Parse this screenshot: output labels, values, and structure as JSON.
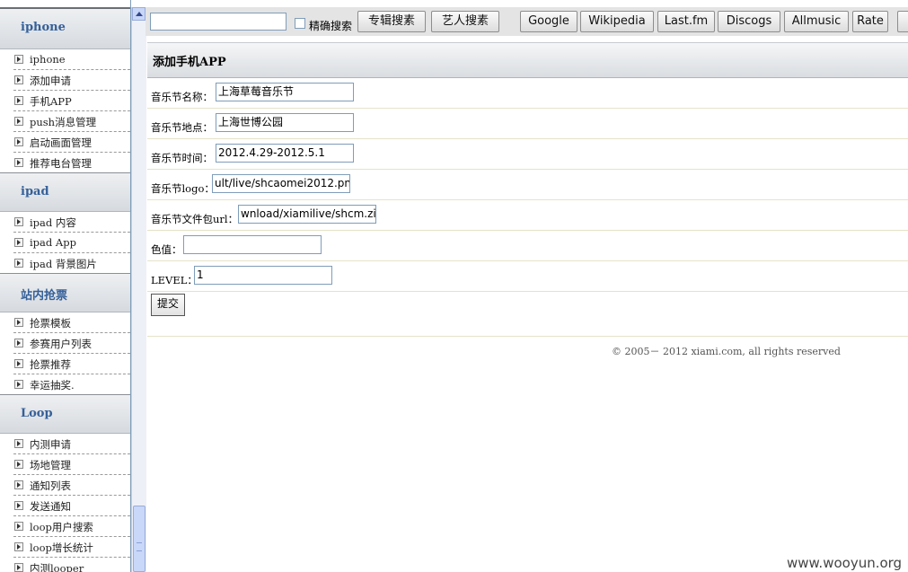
{
  "sidebar": {
    "sections": [
      {
        "title": "iphone",
        "items": [
          "iphone",
          "添加申请",
          "手机APP",
          "push消息管理",
          "启动画面管理",
          "推荐电台管理"
        ]
      },
      {
        "title": "ipad",
        "items": [
          "ipad 内容",
          "ipad App",
          "ipad 背景图片"
        ]
      },
      {
        "title": "站内抢票",
        "items": [
          "抢票模板",
          "参赛用户列表",
          "抢票推荐",
          "幸运抽奖."
        ]
      },
      {
        "title": "Loop",
        "items": [
          "内测申请",
          "场地管理",
          "通知列表",
          "发送通知",
          "loop用户搜索",
          "loop增长统计",
          "内测looper"
        ]
      }
    ]
  },
  "toolbar": {
    "search_value": "",
    "exact_label": "精确搜索",
    "album_search": "专辑搜素",
    "artist_search": "艺人搜素",
    "links": [
      "Google",
      "Wikipedia",
      "Last.fm",
      "Discogs",
      "Allmusic",
      "Rate"
    ]
  },
  "panel": {
    "title": "添加手机APP",
    "fields": [
      {
        "label": "音乐节名称：",
        "value": "上海草莓音乐节"
      },
      {
        "label": "音乐节地点：",
        "value": "上海世博公园"
      },
      {
        "label": "音乐节时间：",
        "value": "2012.4.29-2012.5.1"
      },
      {
        "label": "音乐节logo：",
        "value": "ult/live/shcaomei2012.png"
      },
      {
        "label": "音乐节文件包url：",
        "value": "wnload/xiamilive/shcm.zip"
      },
      {
        "label": "色值：",
        "value": ""
      },
      {
        "label": "LEVEL：",
        "value": "1"
      }
    ],
    "submit": "提交"
  },
  "footer": {
    "copyright": "© 2005－ 2012 xiami.com, all rights reserved"
  },
  "watermark": "www.wooyun.org"
}
